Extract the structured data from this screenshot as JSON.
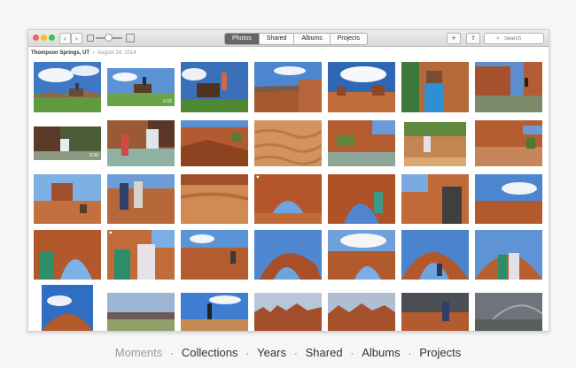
{
  "toolbar": {
    "tabs": [
      {
        "label": "Photos",
        "active": true
      },
      {
        "label": "Shared",
        "active": false
      },
      {
        "label": "Albums",
        "active": false
      },
      {
        "label": "Projects",
        "active": false
      }
    ],
    "add_label": "+",
    "search_placeholder": "Search"
  },
  "moment": {
    "place": "Thompson Springs, UT",
    "date": "August 24, 2014"
  },
  "bottom_nav": {
    "items": [
      "Moments",
      "Collections",
      "Years",
      "Shared",
      "Albums",
      "Projects"
    ],
    "active_index": 0
  },
  "photo_badges": {
    "video_1": "0:15",
    "video_2": "0:20"
  },
  "colors": {
    "sky": "#4a7fc9",
    "red_rock": "#b5542b",
    "sand": "#d99a5f",
    "active_tab": "#666666"
  }
}
